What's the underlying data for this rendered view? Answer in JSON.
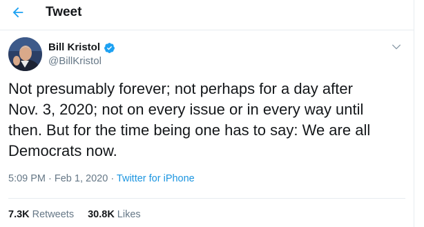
{
  "header": {
    "title": "Tweet"
  },
  "author": {
    "name": "Bill Kristol",
    "handle": "@BillKristol"
  },
  "tweet": {
    "text": "Not presumably forever; not perhaps for a day after\nNov. 3, 2020; not on every issue or in every way until\nthen. But for the time being one has to say: We are all\nDemocrats now.",
    "time": "5:09 PM",
    "separator_1": " · ",
    "date": "Feb 1, 2020",
    "separator_2": " · ",
    "source": "Twitter for iPhone"
  },
  "stats": {
    "retweets_count": "7.3K",
    "retweets_label": "Retweets",
    "likes_count": "30.8K",
    "likes_label": "Likes"
  },
  "colors": {
    "accent": "#1da1f2",
    "link": "#1b95e0",
    "secondary_text": "#657786",
    "border": "#e6ecf0"
  },
  "icons": {
    "back": "arrow-left-icon",
    "verified": "verified-badge-icon",
    "more": "chevron-down-icon"
  }
}
